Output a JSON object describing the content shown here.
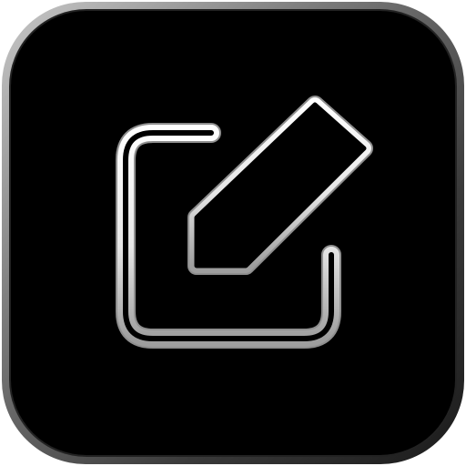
{
  "icon": {
    "name": "compose-edit-icon",
    "glyph": "pencil-on-square",
    "colors": {
      "frame_outer": "#9a9a9a",
      "frame_inner": "#2a2a2a",
      "background": "#000000",
      "stroke_light": "#ffffff",
      "stroke_mid": "#d9d9d9",
      "stroke_dark": "#8f8f8f"
    }
  }
}
